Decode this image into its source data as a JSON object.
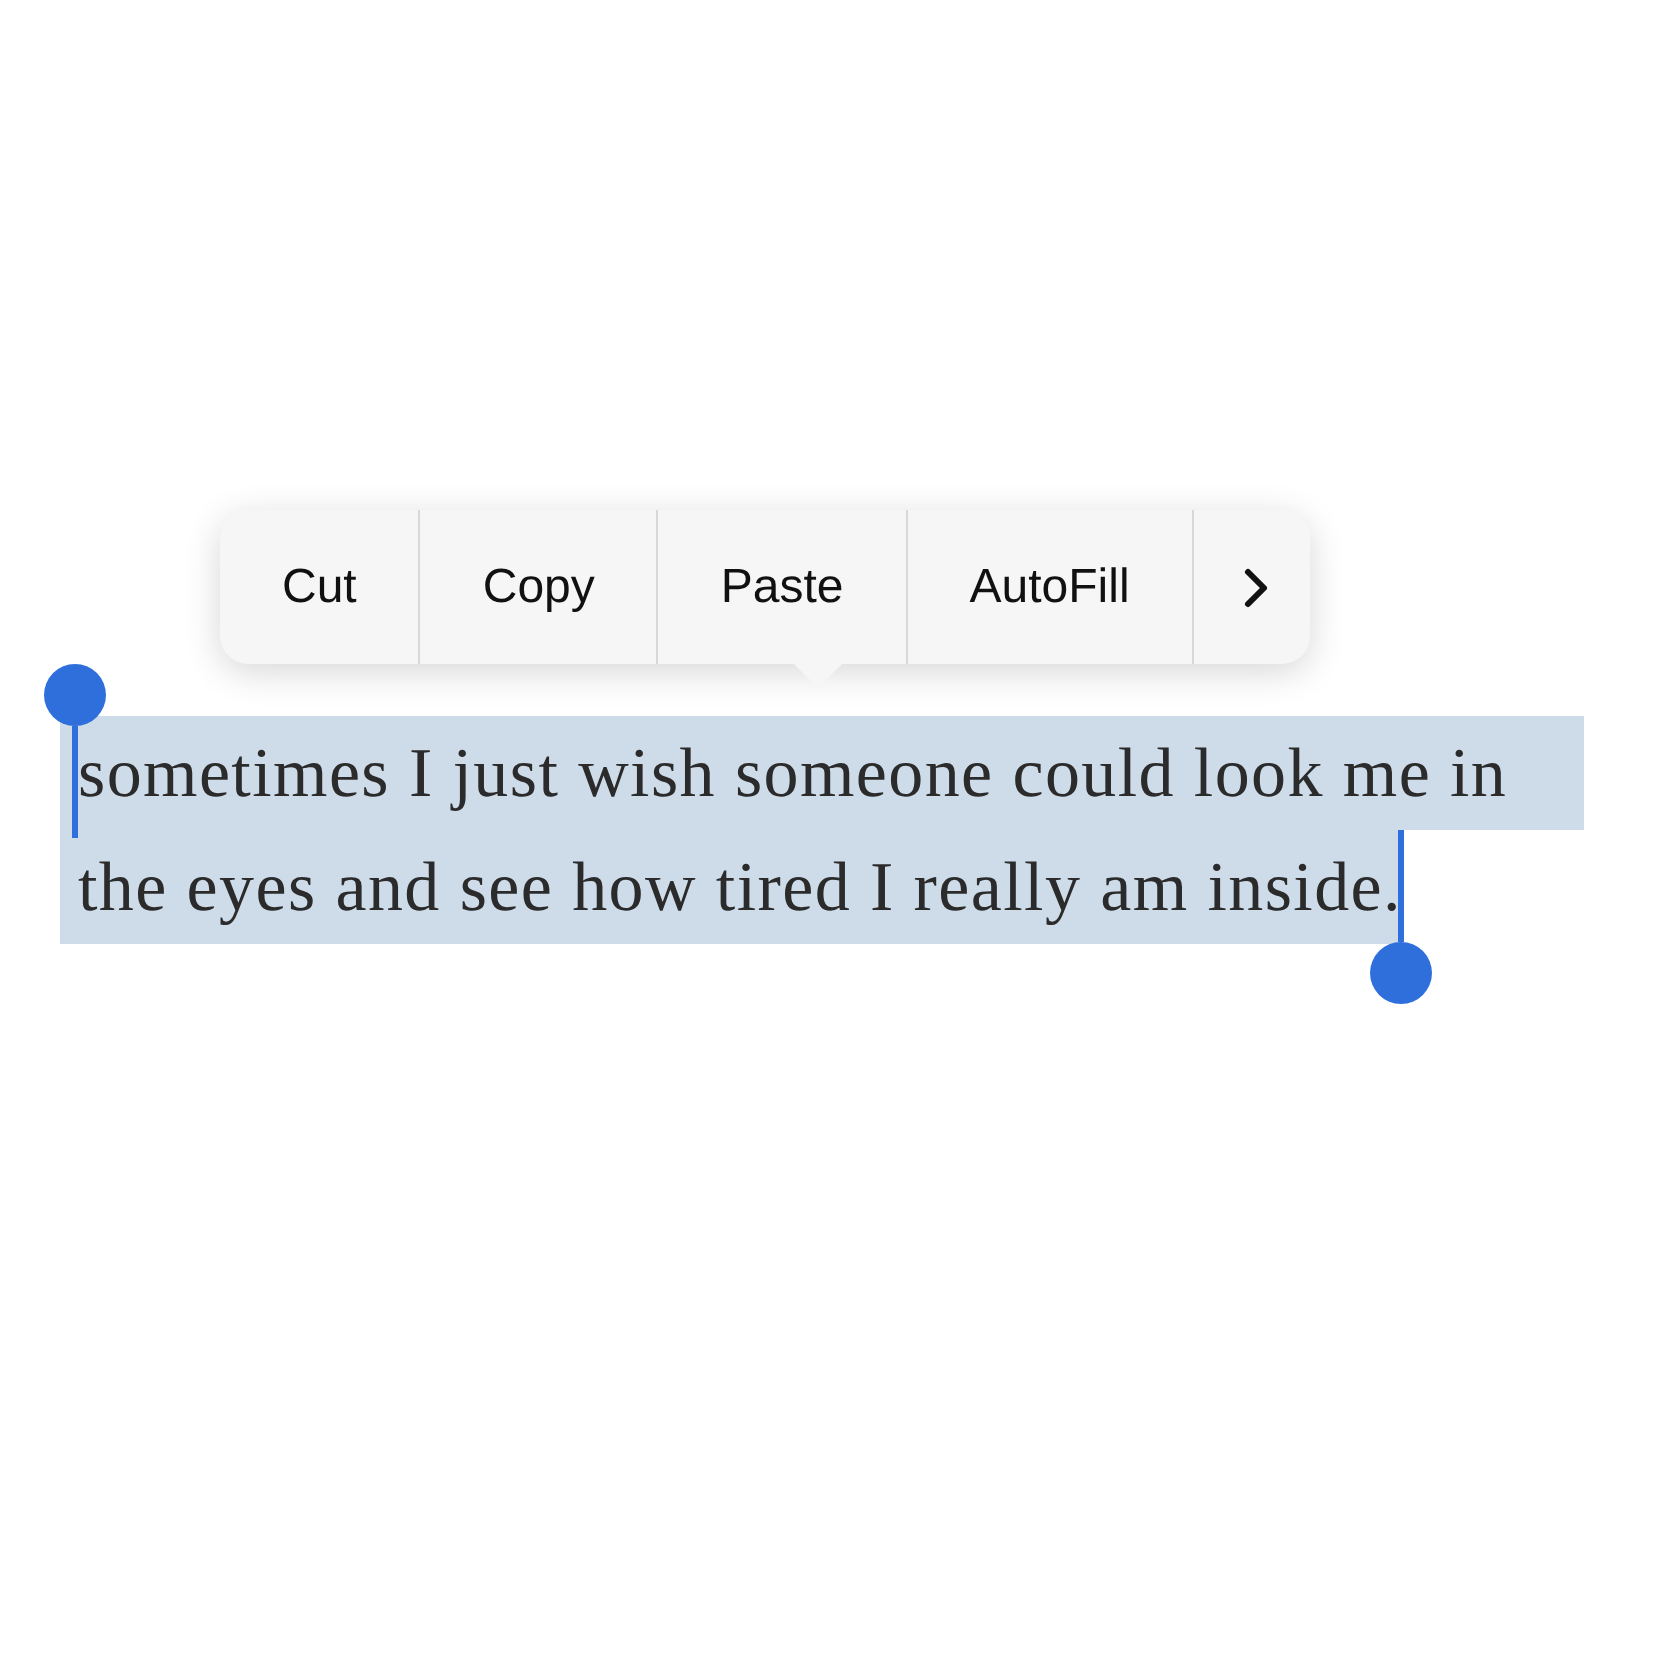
{
  "edit_menu": {
    "items": [
      {
        "kind": "action",
        "label": "Cut"
      },
      {
        "kind": "action",
        "label": "Copy"
      },
      {
        "kind": "action",
        "label": "Paste"
      },
      {
        "kind": "action",
        "label": "AutoFill"
      },
      {
        "kind": "more"
      }
    ]
  },
  "selected_text": {
    "lines": [
      "sometimes I just wish someone could look me in",
      "the eyes and see how tired I really am inside."
    ]
  }
}
